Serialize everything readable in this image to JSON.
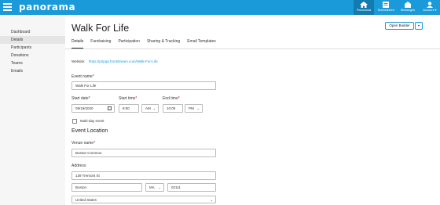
{
  "topbar": {
    "logo": "panorama",
    "nav": [
      {
        "label": "Panorama",
        "icon": "home-icon",
        "active": true
      },
      {
        "label": "Teamraisers",
        "icon": "list-icon",
        "active": false
      },
      {
        "label": "Messages",
        "icon": "mail-icon",
        "active": false
      },
      {
        "label": "Account ▾",
        "icon": "user-icon",
        "active": false
      }
    ]
  },
  "sidebar": {
    "items": [
      {
        "label": "Dashboard"
      },
      {
        "label": "Details"
      },
      {
        "label": "Participants"
      },
      {
        "label": "Donations"
      },
      {
        "label": "Teams"
      },
      {
        "label": "Emails"
      }
    ],
    "active": "Details"
  },
  "header": {
    "title": "Walk For Life",
    "open_builder": "Open Builder",
    "dropdown_caret": "▾"
  },
  "tabs": [
    "Details",
    "Fundraising",
    "Participation",
    "Sharing & Tracking",
    "Email Templates"
  ],
  "website": {
    "label": "Website:",
    "url": "https://p2pqa.frontstream.com/Walk-For-Life"
  },
  "form": {
    "event_name_label": "Event name",
    "event_name": "Walk For Life",
    "start_date_label": "Start date",
    "start_date": "09/19/2020",
    "start_time_label": "Start time",
    "start_time": "8:00",
    "start_ampm": "AM",
    "end_time_label": "End time",
    "end_time": "10:00",
    "end_ampm": "PM",
    "required_mark": "*",
    "multiday_label": "Multi-day event",
    "location_heading": "Event Location",
    "venue_label": "Venue name",
    "venue": "Boston Common",
    "address_label": "Address",
    "street": "139 Tremont St",
    "city": "Boston",
    "state": "MA",
    "zip": "02111",
    "country": "United States"
  }
}
